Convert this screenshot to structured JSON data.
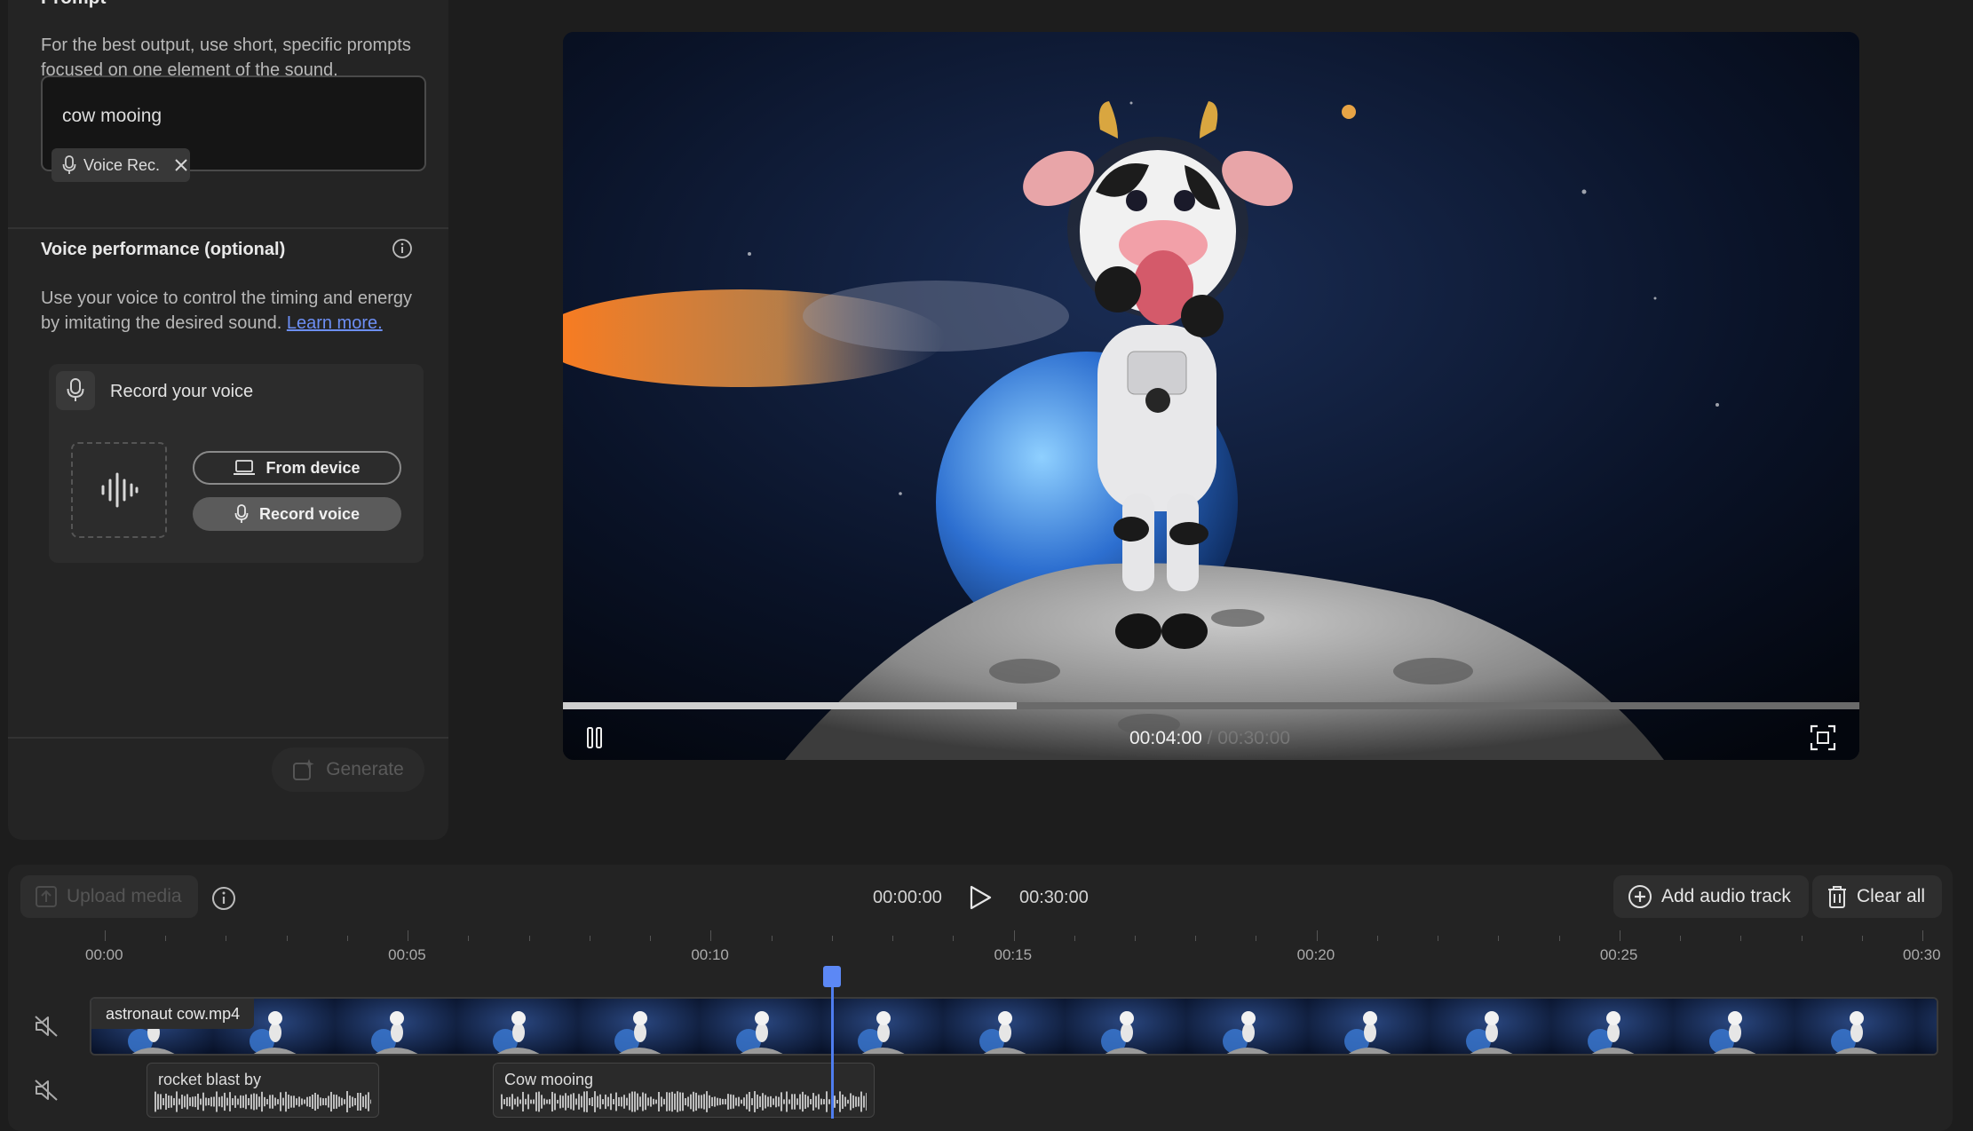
{
  "left_panel": {
    "prompt_heading": "Prompt",
    "prompt_hint": "For the best output, use short, specific prompts focused on one element of the sound.",
    "prompt_value": "cow mooing",
    "voice_tag_label": "Voice Rec.",
    "voice_heading": "Voice performance (optional)",
    "voice_hint": "Use your voice to control the timing and energy by imitating the desired sound.",
    "learn_more": "Learn more.",
    "record_title": "Record your voice",
    "from_device": "From device",
    "record_voice": "Record voice",
    "generate": "Generate"
  },
  "video": {
    "current_time": "00:04:00",
    "duration": "00:30:00",
    "progress": 0.35
  },
  "timeline": {
    "upload_media": "Upload media",
    "start_time": "00:00:00",
    "end_time": "00:30:00",
    "add_audio_track": "Add audio track",
    "clear_all": "Clear all",
    "ruler": [
      "00:00",
      "00:05",
      "00:10",
      "00:15",
      "00:20",
      "00:25",
      "00:30"
    ],
    "video_clip": "astronaut cow.mp4",
    "audio_clips": [
      "rocket blast by",
      "Cow mooing"
    ],
    "playhead_seconds": 12
  },
  "colors": {
    "accent": "#4e7df0",
    "link": "#6d8ff5"
  }
}
